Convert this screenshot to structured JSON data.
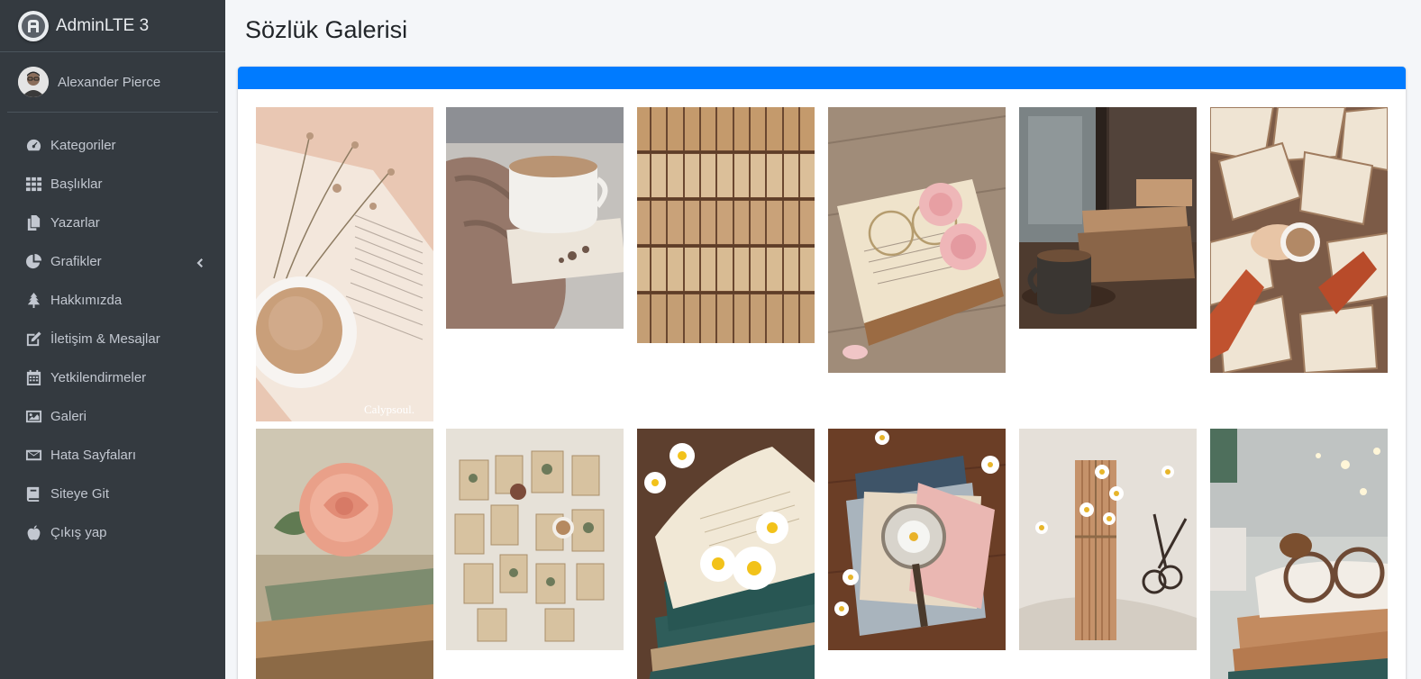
{
  "brand": {
    "title": "AdminLTE 3",
    "logo_icon": "adminlte-logo-icon"
  },
  "user": {
    "name": "Alexander Pierce"
  },
  "sidebar": {
    "items": [
      {
        "label": "Kategoriler",
        "icon": "tachometer-icon"
      },
      {
        "label": "Başlıklar",
        "icon": "grid-icon"
      },
      {
        "label": "Yazarlar",
        "icon": "copy-icon"
      },
      {
        "label": "Grafikler",
        "icon": "pie-chart-icon"
      },
      {
        "label": "Hakkımızda",
        "icon": "tree-icon"
      },
      {
        "label": "İletişim & Mesajlar",
        "icon": "edit-icon"
      },
      {
        "label": "Yetkilendirmeler",
        "icon": "calendar-icon"
      },
      {
        "label": "Galeri",
        "icon": "image-icon"
      },
      {
        "label": "Hata Sayfaları",
        "icon": "envelope-icon"
      },
      {
        "label": "Siteye Git",
        "icon": "book-icon"
      },
      {
        "label": "Çıkış yap",
        "icon": "apple-icon"
      }
    ]
  },
  "page": {
    "title": "Sözlük Galerisi"
  },
  "colors": {
    "sidebar_bg": "#343a40",
    "accent": "#007bff",
    "content_bg": "#f4f6f9"
  },
  "gallery": {
    "photos": [
      {
        "subject": "open book with dried flowers and coffee cup",
        "watermark": "Calypsoul."
      },
      {
        "subject": "coffee cup on knit blanket with open book"
      },
      {
        "subject": "stacked open old books"
      },
      {
        "subject": "glasses and pink roses on open book"
      },
      {
        "subject": "coffee mug and old books by rainy window"
      },
      {
        "subject": "hands holding coffee over scattered books"
      },
      {
        "subject": "pink rose on old books"
      },
      {
        "subject": "flat lay of vintage botanical books"
      },
      {
        "subject": "daisies on stack of open books"
      },
      {
        "subject": "magnifier and daisies on letters"
      },
      {
        "subject": "book bundle tied with twine and daisies"
      },
      {
        "subject": "glasses on old books with fairy lights"
      }
    ]
  }
}
